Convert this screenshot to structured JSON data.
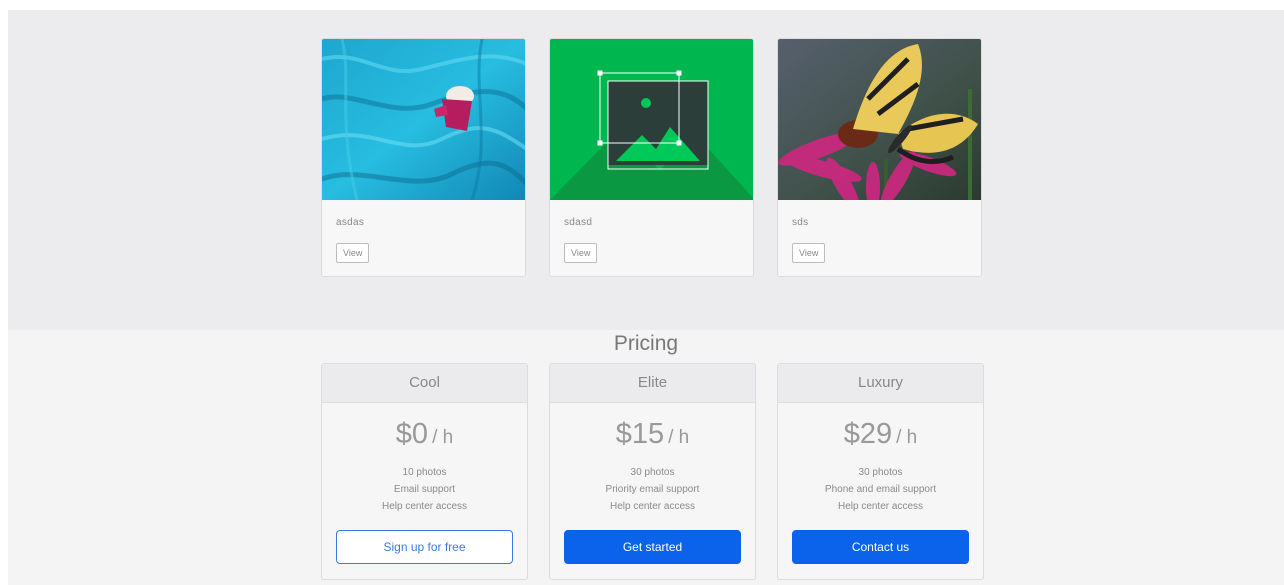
{
  "gallery": {
    "cards": [
      {
        "caption": "asdas",
        "view_label": "View",
        "image": "blue-fabric-photo"
      },
      {
        "caption": "sdasd",
        "view_label": "View",
        "image": "image-placeholder-icon"
      },
      {
        "caption": "sds",
        "view_label": "View",
        "image": "butterfly-photo"
      }
    ]
  },
  "pricing": {
    "title": "Pricing",
    "plans": [
      {
        "name": "Cool",
        "price": "$0",
        "unit": "/ h",
        "features": [
          "10 photos",
          "Email support",
          "Help center access"
        ],
        "cta": "Sign up for free",
        "cta_style": "outline"
      },
      {
        "name": "Elite",
        "price": "$15",
        "unit": "/ h",
        "features": [
          "30 photos",
          "Priority email support",
          "Help center access"
        ],
        "cta": "Get started",
        "cta_style": "primary"
      },
      {
        "name": "Luxury",
        "price": "$29",
        "unit": "/ h",
        "features": [
          "30 photos",
          "Phone and email support",
          "Help center access"
        ],
        "cta": "Contact us",
        "cta_style": "primary"
      }
    ]
  },
  "colors": {
    "accent": "#0a63ea",
    "placeholder_green": "#00b74f",
    "gallery_bg": "#ececee"
  }
}
